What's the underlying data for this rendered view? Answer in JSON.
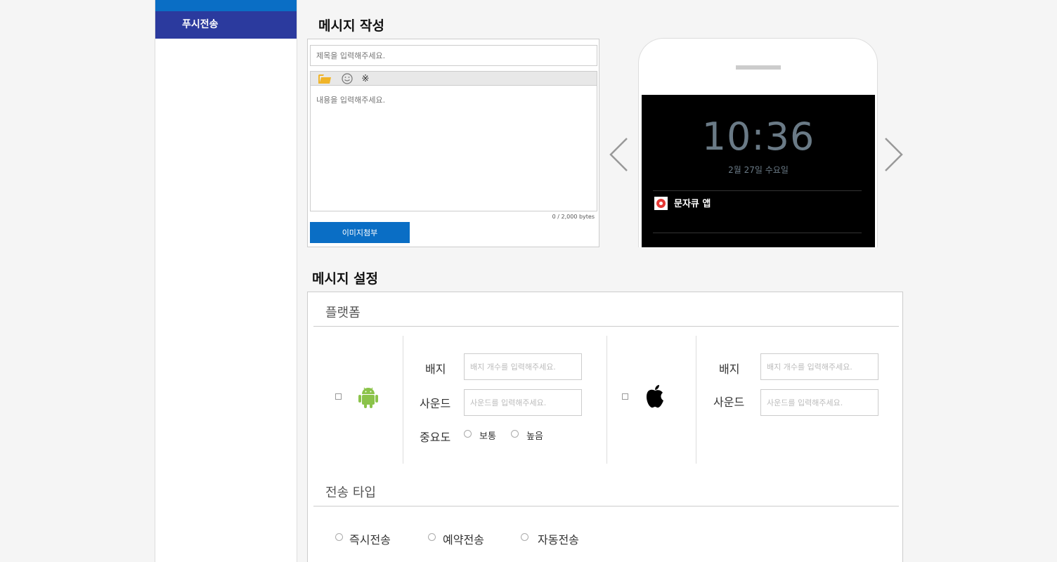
{
  "sidebar": {
    "item_label": "푸시전송"
  },
  "compose": {
    "heading": "메시지 작성",
    "title_placeholder": "제목을 입력해주세요.",
    "body_placeholder": "내용을 입력해주세요.",
    "byte_count": "0 / 2,000 bytes",
    "attach_button": "이미지첨부",
    "toolbar_symbol": "※"
  },
  "preview": {
    "time": "10:36",
    "date": "2월 27일 수요일",
    "app_name": "문자큐 앱"
  },
  "settings": {
    "heading": "메시지 설정",
    "platform_title": "플랫폼",
    "android": {
      "badge_label": "배지",
      "badge_placeholder": "배지 개수를 입력해주세요.",
      "sound_label": "사운드",
      "sound_placeholder": "사운드를 입력해주세요.",
      "priority_label": "중요도",
      "priority_options": [
        "보통",
        "높음"
      ]
    },
    "ios": {
      "badge_label": "배지",
      "badge_placeholder": "배지 개수를 입력해주세요.",
      "sound_label": "사운드",
      "sound_placeholder": "사운드를 입력해주세요."
    },
    "send_type_title": "전송 타입",
    "send_types": [
      "즉시전송",
      "예약전송",
      "자동전송"
    ]
  },
  "colors": {
    "accent": "#0a6ec5",
    "nav_active": "#2b3a9e",
    "android_green": "#8bc34a"
  }
}
